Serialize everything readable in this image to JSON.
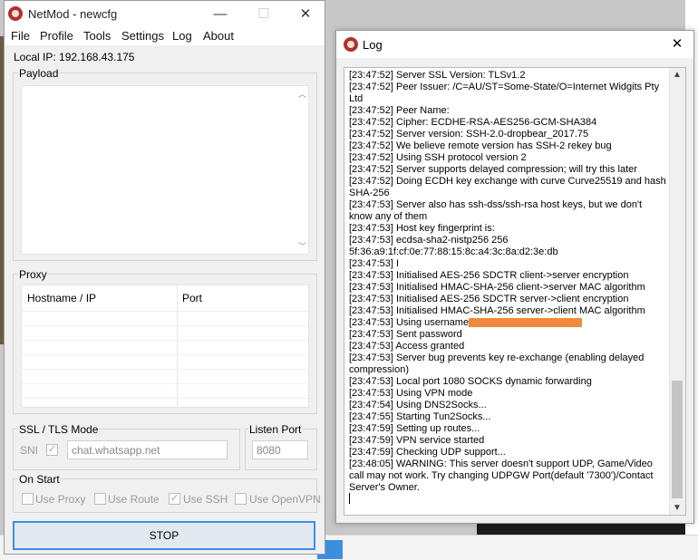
{
  "colors": {
    "accent": "#3c8fe0",
    "redaction": "#f08a3c",
    "window_bg": "#f0f0f0"
  },
  "netmod": {
    "app_icon": "netmod-logo-icon",
    "title": "NetMod - newcfg",
    "caption": {
      "minimize": "—",
      "maximize": "☐",
      "close": "✕"
    },
    "menu": [
      "File",
      "Profile",
      "Tools",
      "Settings",
      "Log",
      "About"
    ],
    "local_ip_label": "Local IP:",
    "local_ip": "192.168.43.175",
    "payload": {
      "label": "Payload",
      "value": ""
    },
    "proxy": {
      "label": "Proxy",
      "columns": [
        "Hostname / IP",
        "Port"
      ]
    },
    "ssl_tls": {
      "label": "SSL / TLS Mode",
      "sni_label": "SNI",
      "sni_checked": true,
      "sni_value": "chat.whatsapp.net"
    },
    "listen_port": {
      "label": "Listen Port",
      "value": "8080"
    },
    "on_start": {
      "label": "On Start",
      "options": [
        {
          "label": "Use Proxy",
          "checked": false
        },
        {
          "label": "Use Route",
          "checked": false
        },
        {
          "label": "Use SSH",
          "checked": true
        },
        {
          "label": "Use OpenVPN",
          "checked": false
        }
      ]
    },
    "stop_button": "STOP"
  },
  "log": {
    "title": "Log",
    "close": "✕",
    "scroll_up": "▲",
    "scroll_down": "▼",
    "text": "[23:47:52] Server SSL Version: TLSv1.2\n[23:47:52] Peer Issuer: /C=AU/ST=Some-State/O=Internet Widgits Pty Ltd\n[23:47:52] Peer Name:\n[23:47:52] Cipher: ECDHE-RSA-AES256-GCM-SHA384\n[23:47:52] Server version: SSH-2.0-dropbear_2017.75\n[23:47:52] We believe remote version has SSH-2 rekey bug\n[23:47:52] Using SSH protocol version 2\n[23:47:52] Server supports delayed compression; will try this later\n[23:47:52] Doing ECDH key exchange with curve Curve25519 and hash SHA-256\n[23:47:53] Server also has ssh-dss/ssh-rsa host keys, but we don't know any of them\n[23:47:53] Host key fingerprint is:\n[23:47:53] ecdsa-sha2-nistp256 256\n5f:36:a9:1f:cf:0e:77:88:15:8c:a4:3c:8a:d2:3e:db\n[23:47:53] I\n[23:47:53] Initialised AES-256 SDCTR client->server encryption\n[23:47:53] Initialised HMAC-SHA-256 client->server MAC algorithm\n[23:47:53] Initialised AES-256 SDCTR server->client encryption\n[23:47:53] Initialised HMAC-SHA-256 server->client MAC algorithm\n[23:47:53] Using username\n[23:47:53] Sent password\n[23:47:53] Access granted\n[23:47:53] Server bug prevents key re-exchange (enabling delayed compression)\n[23:47:53] Local port 1080 SOCKS dynamic forwarding\n[23:47:53] Using VPN mode\n[23:47:54] Using DNS2Socks...\n[23:47:55] Starting Tun2Socks...\n[23:47:59] Setting up routes...\n[23:47:59] VPN service started\n[23:47:59] Checking UDP support...\n[23:48:05] WARNING: This server doesn't support UDP, Game/Video call may not work. Try changing UDPGW Port(default '7300')/Contact Server's Owner."
  }
}
